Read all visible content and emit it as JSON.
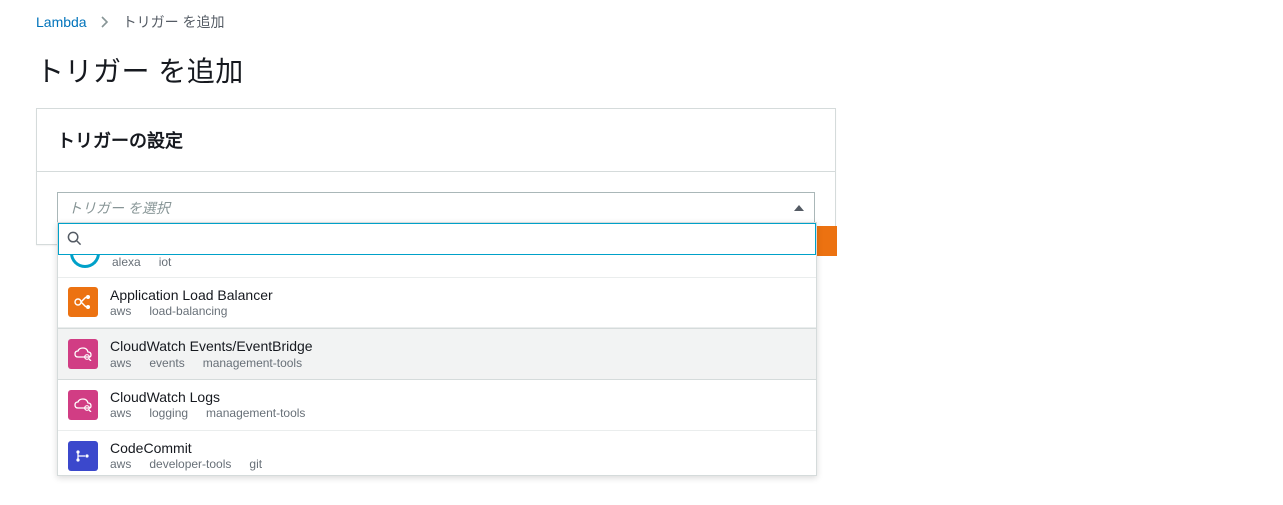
{
  "breadcrumb": {
    "root": "Lambda",
    "current": "トリガー を追加"
  },
  "page_title": "トリガー を追加",
  "panel_title": "トリガーの設定",
  "select": {
    "placeholder": "トリガー を選択",
    "search_placeholder": ""
  },
  "options": {
    "alexa_partial": {
      "tags": [
        "alexa",
        "iot"
      ]
    },
    "alb": {
      "title": "Application Load Balancer",
      "tags": [
        "aws",
        "load-balancing"
      ]
    },
    "cwe": {
      "title": "CloudWatch Events/EventBridge",
      "tags": [
        "aws",
        "events",
        "management-tools"
      ]
    },
    "cwl": {
      "title": "CloudWatch Logs",
      "tags": [
        "aws",
        "logging",
        "management-tools"
      ]
    },
    "cc": {
      "title": "CodeCommit",
      "tags": [
        "aws",
        "developer-tools",
        "git"
      ]
    }
  }
}
